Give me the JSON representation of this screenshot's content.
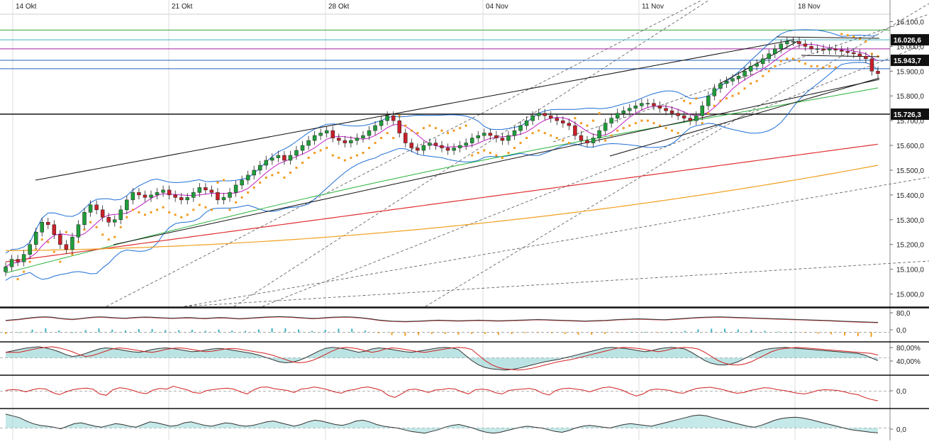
{
  "colors": {
    "up": "#1f9d3a",
    "down": "#c8202a",
    "bollinger": "#1f6fd6",
    "ema_short": "#c020c0",
    "sma_green": "#2bb33a",
    "sma_red": "#e03030",
    "sma_orange": "#f0a020",
    "sar": "#f39a1e",
    "trend": "#111111",
    "fib": "#555555",
    "grid": "#dddddd",
    "hline_green": "#3aa43a",
    "hline_teal": "#3bb0c0",
    "hline_purple": "#a020a0",
    "hline_blue": "#2060c0",
    "tag_bg": "#111111"
  },
  "price_tags": [
    "16.026,6",
    "15.943,7",
    "15.726,3"
  ],
  "indicator_ticks": {
    "panel1": [
      "80,0",
      "0,0"
    ],
    "panel2": [
      "80,00%",
      "40,00%"
    ],
    "panel3": [
      "0,0"
    ],
    "panel4": [
      "0,0"
    ]
  },
  "chart_data": [
    {
      "type": "candlestick",
      "x_labels": [
        "14 Okt",
        "21 Okt",
        "28 Okt",
        "04 Nov",
        "11 Nov",
        "18 Nov"
      ],
      "y_ticks": [
        "16.100,0",
        "16.000,0",
        "15.900,0",
        "15.800,0",
        "15.700,0",
        "15.600,0",
        "15.500,0",
        "15.400,0",
        "15.300,0",
        "15.200,0",
        "15.100,0",
        "15.000,0"
      ],
      "ylim": [
        14950,
        16130
      ],
      "grid": true,
      "horizontal_levels": [
        16066,
        16026.6,
        15990,
        15943.7,
        15910,
        15726.3
      ],
      "close_path": [
        15110,
        15140,
        15130,
        15160,
        15200,
        15250,
        15290,
        15280,
        15240,
        15200,
        15180,
        15230,
        15280,
        15330,
        15360,
        15340,
        15310,
        15290,
        15300,
        15340,
        15380,
        15410,
        15400,
        15390,
        15400,
        15410,
        15420,
        15400,
        15390,
        15380,
        15390,
        15410,
        15430,
        15420,
        15410,
        15380,
        15390,
        15410,
        15440,
        15460,
        15480,
        15500,
        15520,
        15540,
        15550,
        15560,
        15540,
        15560,
        15580,
        15600,
        15620,
        15640,
        15650,
        15660,
        15630,
        15620,
        15610,
        15620,
        15630,
        15640,
        15660,
        15680,
        15700,
        15720,
        15700,
        15650,
        15610,
        15590,
        15580,
        15600,
        15610,
        15600,
        15590,
        15580,
        15590,
        15600,
        15610,
        15630,
        15640,
        15650,
        15640,
        15630,
        15620,
        15640,
        15660,
        15680,
        15700,
        15720,
        15730,
        15720,
        15710,
        15700,
        15690,
        15680,
        15640,
        15620,
        15610,
        15630,
        15660,
        15690,
        15710,
        15730,
        15740,
        15750,
        15760,
        15770,
        15770,
        15760,
        15750,
        15740,
        15730,
        15720,
        15710,
        15700,
        15720,
        15760,
        15800,
        15830,
        15850,
        15860,
        15870,
        15880,
        15900,
        15920,
        15930,
        15950,
        15970,
        15990,
        16010,
        16020,
        16020,
        16010,
        16000,
        15990,
        15990,
        15985,
        15990,
        15985,
        15980,
        15975,
        15970,
        15960,
        15950,
        15900,
        15890
      ]
    },
    {
      "type": "line",
      "name": "",
      "yticks": [
        "80,0",
        "0,0"
      ],
      "ylim": [
        -30,
        110
      ],
      "values": [
        30,
        35,
        40,
        48,
        55,
        60,
        62,
        58,
        50,
        44,
        40,
        45,
        52,
        58,
        62,
        60,
        55,
        52,
        50,
        54,
        58,
        60,
        58,
        54,
        52,
        50,
        52,
        55,
        54,
        50,
        48,
        52,
        55,
        54,
        50,
        46,
        48,
        52,
        56,
        60,
        62,
        64,
        62,
        60,
        56,
        52,
        48,
        50,
        54,
        58,
        60,
        62,
        60,
        56,
        50,
        42,
        34,
        28,
        24,
        22,
        20,
        22,
        24,
        26,
        30,
        32,
        30,
        28,
        26,
        28,
        30,
        32,
        30,
        28,
        26,
        28,
        30,
        32,
        34,
        36,
        38,
        36,
        34,
        32,
        30,
        28,
        26,
        24,
        26,
        28,
        30,
        34,
        38,
        40,
        42,
        44,
        42,
        40,
        38,
        36,
        40,
        44,
        48,
        52,
        56,
        58,
        60,
        62,
        60,
        58,
        56,
        54,
        52,
        50,
        48,
        46,
        44,
        42,
        40,
        38,
        36,
        34,
        32,
        30,
        28,
        25,
        22,
        20,
        18,
        16,
        14,
        12
      ]
    },
    {
      "type": "line",
      "name": "",
      "yticks": [
        "80,00%",
        "40,00%"
      ],
      "ylim": [
        0,
        100
      ],
      "values": [
        70,
        75,
        80,
        85,
        88,
        90,
        86,
        80,
        72,
        62,
        55,
        58,
        66,
        74,
        82,
        86,
        84,
        80,
        76,
        72,
        70,
        74,
        80,
        84,
        86,
        84,
        80,
        76,
        72,
        74,
        78,
        82,
        84,
        82,
        78,
        74,
        70,
        66,
        60,
        52,
        44,
        36,
        32,
        34,
        40,
        50,
        62,
        74,
        84,
        88,
        86,
        82,
        76,
        70,
        74,
        82,
        86,
        84,
        80,
        76,
        72,
        70,
        74,
        78,
        82,
        86,
        88,
        86,
        80,
        60,
        40,
        25,
        15,
        10,
        8,
        6,
        8,
        12,
        18,
        24,
        30,
        36,
        40,
        44,
        50,
        56,
        62,
        68,
        74,
        80,
        86,
        88,
        86,
        84,
        80,
        76,
        72,
        76,
        82,
        86,
        88,
        86,
        82,
        70,
        55,
        40,
        30,
        25,
        24,
        28,
        36,
        48,
        60,
        72,
        80,
        84,
        86,
        88,
        86,
        84,
        82,
        80,
        78,
        76,
        74,
        72,
        70,
        68,
        66,
        60,
        50,
        40
      ]
    },
    {
      "type": "line",
      "name": "",
      "yticks": [
        "0,0"
      ],
      "ylim": [
        -100,
        100
      ],
      "values": [
        5,
        12,
        8,
        -5,
        10,
        20,
        15,
        -10,
        -25,
        -5,
        10,
        18,
        22,
        15,
        -20,
        -30,
        10,
        25,
        18,
        5,
        -12,
        -18,
        8,
        20,
        15,
        35,
        22,
        10,
        -10,
        -15,
        5,
        12,
        18,
        22,
        15,
        -5,
        -20,
        10,
        28,
        30,
        18,
        12,
        5,
        -10,
        15,
        20,
        30,
        22,
        10,
        -5,
        -15,
        5,
        12,
        25,
        30,
        20,
        5,
        -30,
        -45,
        -20,
        10,
        15,
        5,
        -10,
        8,
        12,
        20,
        15,
        -5,
        -20,
        10,
        15,
        8,
        -12,
        -20,
        5,
        12,
        15,
        20,
        10,
        -15,
        -28,
        5,
        18,
        22,
        15,
        8,
        -5,
        10,
        25,
        30,
        20,
        5,
        -18,
        -35,
        -20,
        8,
        15,
        12,
        5,
        -10,
        -15,
        5,
        20,
        25,
        28,
        20,
        10,
        -5,
        -15,
        -10,
        5,
        15,
        25,
        22,
        10,
        5,
        -5,
        -15,
        -20,
        -10,
        5,
        10,
        8,
        5,
        -5,
        -18,
        -25,
        -45,
        -60,
        -70
      ]
    },
    {
      "type": "area",
      "name": "",
      "yticks": [
        "0,0"
      ],
      "ylim": [
        -60,
        100
      ],
      "values": [
        80,
        70,
        60,
        40,
        25,
        15,
        10,
        5,
        -5,
        10,
        25,
        30,
        20,
        10,
        5,
        15,
        25,
        20,
        10,
        5,
        20,
        35,
        30,
        20,
        10,
        15,
        30,
        35,
        25,
        15,
        10,
        20,
        30,
        25,
        15,
        10,
        15,
        25,
        35,
        40,
        30,
        20,
        10,
        20,
        35,
        45,
        40,
        30,
        20,
        15,
        25,
        40,
        45,
        35,
        20,
        10,
        5,
        0,
        -10,
        -20,
        -25,
        -30,
        -20,
        -10,
        5,
        15,
        20,
        10,
        0,
        -15,
        -25,
        -30,
        -25,
        -15,
        -5,
        5,
        10,
        5,
        0,
        -10,
        -20,
        -25,
        -15,
        0,
        10,
        15,
        10,
        5,
        0,
        10,
        20,
        25,
        20,
        15,
        10,
        20,
        30,
        40,
        50,
        60,
        70,
        75,
        70,
        60,
        50,
        40,
        30,
        20,
        10,
        5,
        15,
        30,
        45,
        55,
        60,
        62,
        58,
        50,
        40,
        30,
        20,
        10,
        0,
        -10,
        -15,
        -20,
        -25,
        -28
      ]
    }
  ]
}
